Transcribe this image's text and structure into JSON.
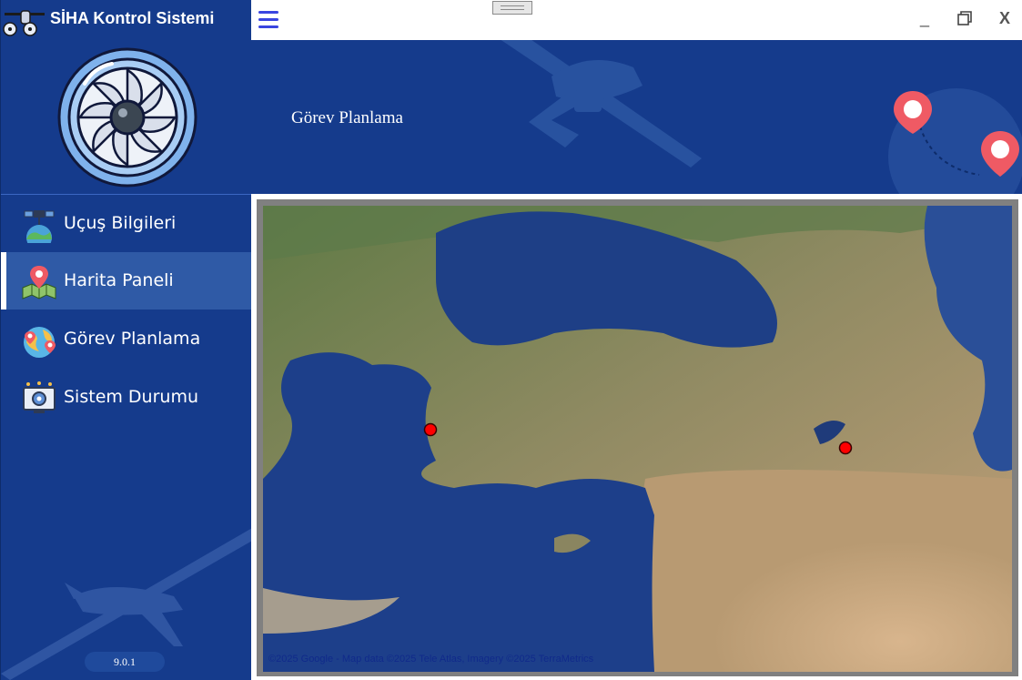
{
  "app": {
    "title": "SİHA Kontrol Sistemi",
    "version": "9.0.1"
  },
  "window": {
    "minimize_label": "_",
    "close_label": "X"
  },
  "sidebar": {
    "items": [
      {
        "label": "Uçuş Bilgileri",
        "icon": "satellite-earth-icon",
        "active": false
      },
      {
        "label": "Harita Paneli",
        "icon": "map-pin-icon",
        "active": true
      },
      {
        "label": "Görev Planlama",
        "icon": "globe-route-icon",
        "active": false
      },
      {
        "label": "Sistem Durumu",
        "icon": "monitor-gear-icon",
        "active": false
      }
    ]
  },
  "header": {
    "title": "Görev Planlama"
  },
  "map": {
    "attribution": "©2025 Google - Map data ©2025 Tele Atlas, Imagery ©2025 TerraMetrics",
    "markers": [
      "marker-west",
      "marker-east"
    ],
    "colors": {
      "marker": "#ff0000",
      "sea": "#1e3f86",
      "land": "#9b8a63"
    }
  },
  "colors": {
    "sidebar_bg": "#153b8c",
    "active_item_bg": "#2f5aa6",
    "menu_icon": "#3a45e0",
    "pin": "#ef5a64"
  }
}
